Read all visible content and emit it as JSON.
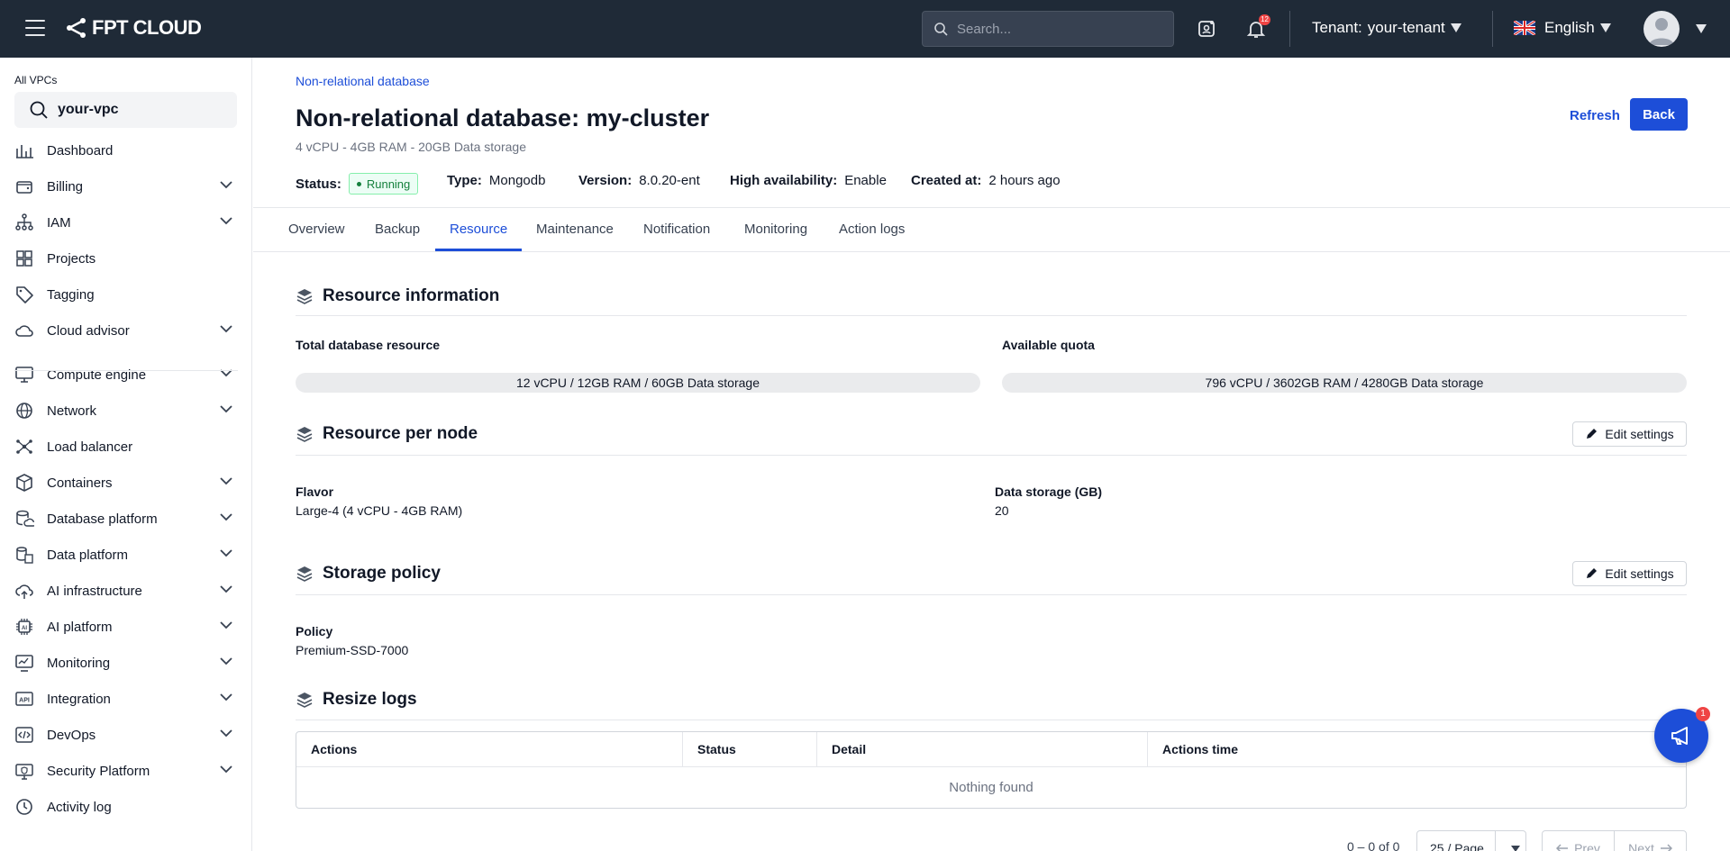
{
  "topbar": {
    "brand": "FPT CLOUD",
    "search_placeholder": "Search...",
    "notification_count": "12",
    "tenant_label": "Tenant:",
    "tenant_value": "your-tenant",
    "language": "English"
  },
  "sidebar": {
    "vpc_label": "All VPCs",
    "vpc_value": "your-vpc",
    "items": [
      {
        "label": "Dashboard",
        "icon": "dashboard-icon"
      },
      {
        "label": "Billing",
        "icon": "wallet-icon"
      },
      {
        "label": "IAM",
        "icon": "hierarchy-icon"
      },
      {
        "label": "Projects",
        "icon": "grid-icon"
      },
      {
        "label": "Tagging",
        "icon": "tag-icon"
      },
      {
        "label": "Cloud advisor",
        "icon": "cloud-icon"
      },
      {
        "label": "Compute engine",
        "icon": "monitor-icon"
      },
      {
        "label": "Network",
        "icon": "globe-icon"
      },
      {
        "label": "Load balancer",
        "icon": "nodes-icon"
      },
      {
        "label": "Containers",
        "icon": "box-icon"
      },
      {
        "label": "Database platform",
        "icon": "database-icon"
      },
      {
        "label": "Data platform",
        "icon": "data-icon"
      },
      {
        "label": "AI infrastructure",
        "icon": "cloud-upload-icon"
      },
      {
        "label": "AI platform",
        "icon": "chip-icon"
      },
      {
        "label": "Monitoring",
        "icon": "monitoring-icon"
      },
      {
        "label": "Integration",
        "icon": "api-icon"
      },
      {
        "label": "DevOps",
        "icon": "code-icon"
      },
      {
        "label": "Security Platform",
        "icon": "shield-icon"
      },
      {
        "label": "Activity log",
        "icon": "clock-icon"
      }
    ]
  },
  "header": {
    "breadcrumb": "Non-relational database",
    "title": "Non-relational database: my-cluster",
    "subtitle": "4 vCPU - 4GB RAM - 20GB Data storage",
    "refresh": "Refresh",
    "back": "Back",
    "status_label": "Status:",
    "status_value": "Running",
    "type_label": "Type:",
    "type_value": "Mongodb",
    "version_label": "Version:",
    "version_value": "8.0.20-ent",
    "ha_label": "High availability:",
    "ha_value": "Enable",
    "created_label": "Created at:",
    "created_value": "2 hours ago"
  },
  "tabs": [
    "Overview",
    "Backup",
    "Resource",
    "Maintenance",
    "Notification",
    "Monitoring",
    "Action logs"
  ],
  "active_tab": "Resource",
  "resource_info": {
    "title": "Resource information",
    "total_label": "Total database resource",
    "total_value": "12 vCPU / 12GB RAM / 60GB Data storage",
    "quota_label": "Available quota",
    "quota_value": "796 vCPU / 3602GB RAM / 4280GB Data storage"
  },
  "per_node": {
    "title": "Resource per node",
    "edit": "Edit settings",
    "flavor_label": "Flavor",
    "flavor_value": "Large-4 (4 vCPU - 4GB RAM)",
    "storage_label": "Data storage (GB)",
    "storage_value": "20"
  },
  "storage_policy": {
    "title": "Storage policy",
    "edit": "Edit settings",
    "policy_label": "Policy",
    "policy_value": "Premium-SSD-7000"
  },
  "resize_logs": {
    "title": "Resize logs",
    "columns": [
      "Actions",
      "Status",
      "Detail",
      "Actions time"
    ],
    "empty": "Nothing found",
    "pager_info": "0 – 0 of 0",
    "page_size": "25 / Page",
    "prev": "Prev",
    "next": "Next"
  },
  "fab_badge": "1",
  "colors": {
    "accent": "#1d4ed8",
    "topbar": "#1f2a37",
    "running": "#15803d"
  }
}
